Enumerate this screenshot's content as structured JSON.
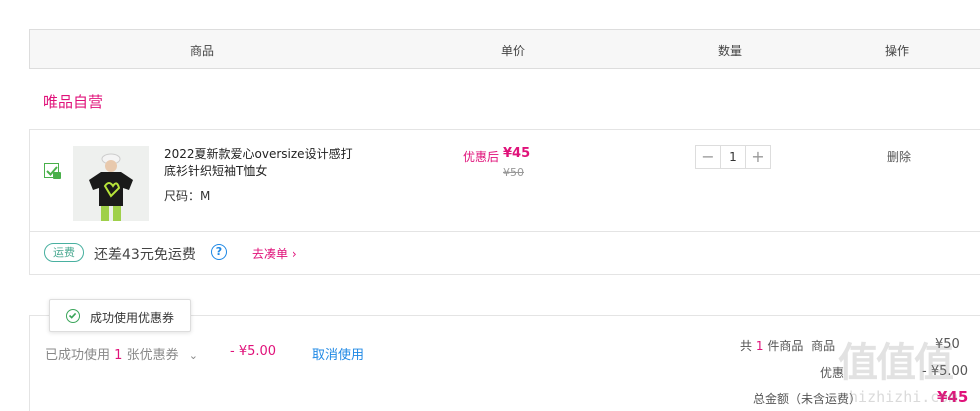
{
  "table_header": {
    "product": "商品",
    "unit_price": "单价",
    "quantity": "数量",
    "actions": "操作"
  },
  "store": {
    "name": "唯品自营"
  },
  "item": {
    "checked": true,
    "title": "2022夏新款爱心oversize设计感打底衫针织短袖T恤女",
    "size": "尺码：M",
    "price_label": "优惠后",
    "price_now": "¥45",
    "price_old": "¥50",
    "quantity": "1",
    "minus": "−",
    "plus": "+",
    "delete": "删除"
  },
  "shipping": {
    "badge": "运费",
    "text": "还差43元免运费",
    "help": "?",
    "addon_link": "去凑单 ›"
  },
  "toast": {
    "text": "成功使用优惠券"
  },
  "coupon": {
    "used_prefix": "已成功使用",
    "used_count": "1",
    "used_suffix": "张优惠券",
    "chevron": "⌄",
    "amount": "- ¥5.00",
    "cancel": "取消使用"
  },
  "summary": {
    "count_prefix": "共",
    "count": "1",
    "count_suffix": "件商品",
    "goods_label": "商品",
    "goods_amount": "¥50",
    "discount_label": "优惠",
    "discount_amount": "- ¥5.00",
    "total_label": "总金额（未含运费）",
    "total_amount": "¥45"
  },
  "watermark": {
    "logo": "值值值",
    "url": "zhizhizhi.com"
  },
  "colors": {
    "accent": "#e0127a",
    "link": "#1e88e5",
    "success": "#3aa55a"
  }
}
